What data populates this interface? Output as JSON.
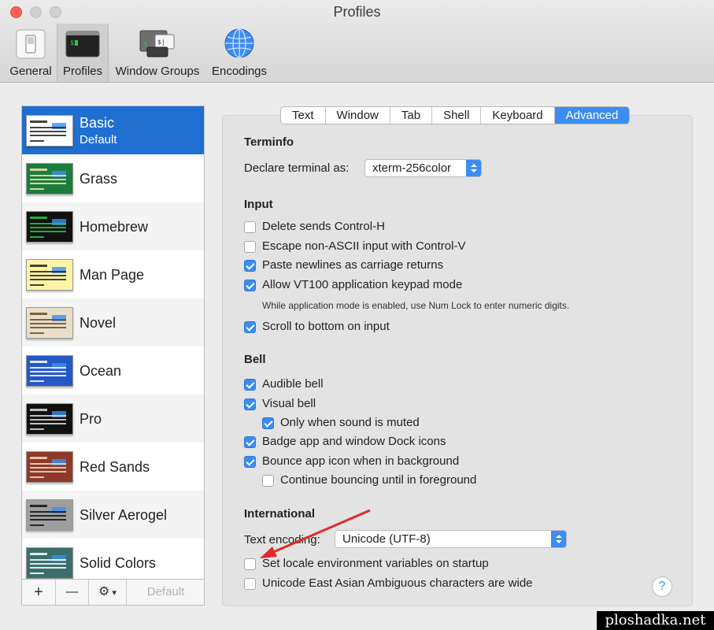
{
  "window": {
    "title": "Profiles"
  },
  "toolbar": [
    {
      "label": "General",
      "icon": "general-switch-icon"
    },
    {
      "label": "Profiles",
      "icon": "terminal-icon",
      "selected": true
    },
    {
      "label": "Window Groups",
      "icon": "window-groups-icon"
    },
    {
      "label": "Encodings",
      "icon": "globe-icon"
    }
  ],
  "profiles": [
    {
      "name": "Basic",
      "sub": "Default",
      "bg": "#ffffff",
      "fg": "#222222",
      "selected": true
    },
    {
      "name": "Grass",
      "bg": "#1b7c3c",
      "fg": "#f4e8a8"
    },
    {
      "name": "Homebrew",
      "bg": "#111111",
      "fg": "#27c93f"
    },
    {
      "name": "Man Page",
      "bg": "#fdf4a8",
      "fg": "#222222"
    },
    {
      "name": "Novel",
      "bg": "#e8dfc8",
      "fg": "#6b4a2b"
    },
    {
      "name": "Ocean",
      "bg": "#2458c4",
      "fg": "#ffffff"
    },
    {
      "name": "Pro",
      "bg": "#111111",
      "fg": "#dddddd"
    },
    {
      "name": "Red Sands",
      "bg": "#8e3a2a",
      "fg": "#f2dcc0"
    },
    {
      "name": "Silver Aerogel",
      "bg": "#9e9e9e",
      "fg": "#111111"
    },
    {
      "name": "Solid Colors",
      "bg": "#3b6e6a",
      "fg": "#ffffff"
    }
  ],
  "sidebar_footer": {
    "add": "+",
    "remove": "—",
    "gear": "⚙",
    "default": "Default"
  },
  "tabs": [
    "Text",
    "Window",
    "Tab",
    "Shell",
    "Keyboard",
    "Advanced"
  ],
  "active_tab": "Advanced",
  "terminfo": {
    "heading": "Terminfo",
    "declare_label": "Declare terminal as:",
    "declare_value": "xterm-256color"
  },
  "input": {
    "heading": "Input",
    "options": [
      {
        "label": "Delete sends Control-H",
        "checked": false
      },
      {
        "label": "Escape non-ASCII input with Control-V",
        "checked": false
      },
      {
        "label": "Paste newlines as carriage returns",
        "checked": true
      },
      {
        "label": "Allow VT100 application keypad mode",
        "checked": true
      },
      {
        "label": "Scroll to bottom on input",
        "checked": true
      }
    ],
    "note": "While application mode is enabled, use Num Lock to enter numeric digits."
  },
  "bell": {
    "heading": "Bell",
    "options": [
      {
        "label": "Audible bell",
        "checked": true
      },
      {
        "label": "Visual bell",
        "checked": true
      },
      {
        "label": "Only when sound is muted",
        "checked": true
      },
      {
        "label": "Badge app and window Dock icons",
        "checked": true
      },
      {
        "label": "Bounce app icon when in background",
        "checked": true
      },
      {
        "label": "Continue bouncing until in foreground",
        "checked": false
      }
    ]
  },
  "international": {
    "heading": "International",
    "encoding_label": "Text encoding:",
    "encoding_value": "Unicode (UTF-8)",
    "options": [
      {
        "label": "Set locale environment variables on startup",
        "checked": false
      },
      {
        "label": "Unicode East Asian Ambiguous characters are wide",
        "checked": false
      }
    ]
  },
  "help": "?",
  "watermark": "ploshadka.net",
  "colors": {
    "accent": "#3b8df2",
    "selection": "#1f6fd1",
    "annotation_arrow": "#e02b2b"
  }
}
